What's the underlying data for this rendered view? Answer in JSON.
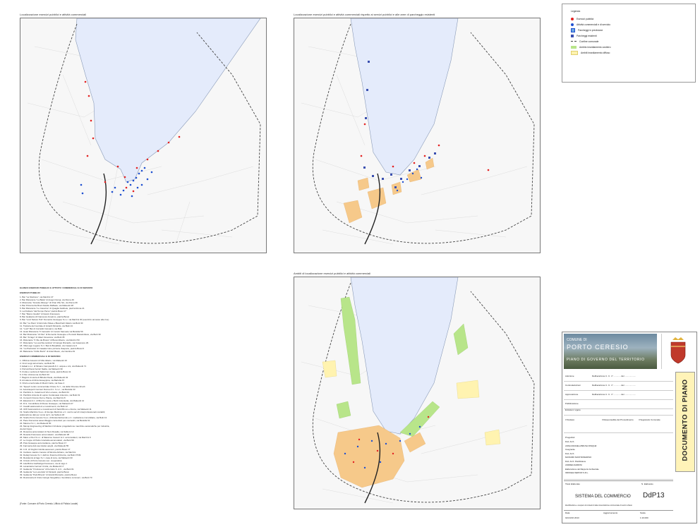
{
  "panels": {
    "p1_title": "Localizzazione esercizi pubblici e attività commerciali",
    "p2_title": "Localizzazione esercizi pubblici e attività commerciali rispetto ai servizi pubblici e alle aree di parcheggio esistenti",
    "p3_title": "Ambiti di localizzazione esercizi pubblici e attività commerciali"
  },
  "colors": {
    "lake": "#e4ebfb",
    "boundary": "#444444",
    "red_dot": "#e32222",
    "blue_dot": "#1e4fd0",
    "parking": "#3a4fb0",
    "orange_area": "#f6c98a",
    "green_area": "#b8e58a",
    "yellow_area": "#fff3b0"
  },
  "legend": {
    "title": "Legenda",
    "items": [
      {
        "label": "Esercizi pubblici",
        "symbol": "red-dot"
      },
      {
        "label": "Attività commerciali e di servizio",
        "symbol": "blue-dot"
      },
      {
        "label": "Parcheggi in previsione",
        "symbol": "parking-planned"
      },
      {
        "label": "Parcheggi esistenti",
        "symbol": "parking-existing"
      },
      {
        "label": "Confine comunale",
        "symbol": "dashed-line"
      },
      {
        "label": "Ambito insediamento costiero",
        "symbol": "green-area"
      },
      {
        "label": "Ambiti insediamento diffuso",
        "symbol": "yellow-area"
      }
    ]
  },
  "list": {
    "heading": "ELENCO ESERCIZI PUBBLICI E ATTIVITA' COMMERCIALI E DI SERVIZIO",
    "section1": "ESERCIZI PUBBLICI",
    "pubblici": [
      "1. Bar \"La Stazione\", via Mazzini 47",
      "2. Bar Ristorante \"La Baita\" di Avogni Giorgi, via Roma 49",
      "3. Ristorante \"Grande Albergo\" di Chan Wiu Sin, via Roma 36",
      "4. Bar Pizzeria Da Bruci Davide Raffaele, via Matteotti 28",
      "5. Bar Ristorante \"Le Casorine\" di Quaglia Gabriele, piazza Roma 21",
      "6. La Flottiera \"dal Tempo Perso\" piazza Bossi 17",
      "7. Bar \"Marco Giudici\" di Gianni Francesco",
      "8. Bar Gelateria di Francesco Anselmo, piazza Bossi",
      "9. Bar \"Lord Nelson Pub\" Demetrio Giuseppe S.n.c. via Mazzini 30 (esercizio annesso alle rive)",
      "10. Bar \"La Pace\" di Ermindo Palea e Bianchetti Valerio via Butti 30",
      "11. Trattoria del Centrale di Girardi Riccardo, via Butti 13",
      "12. \"Lord\" Bar di Corradini Giovanni, via Butti",
      "13. Hotel Ristorante \"Il Cannello\" di Corsini Samuele via Bartolla 59",
      "14. Bar Ristorante \"Al Pan\" di Demetrio Giuseppe e Ponzetti Massimiliano, via Butti 30",
      "15. Bar \"Al lago\" di Valeri Giovanna, via Butti 35",
      "16. Ristorante \"Il Vile da Brusio\" di Bussi Alberto, via Mazzini 50",
      "17. Ristorante \"La vecchia cantina\" di Giorgio Riccardo, via Casamore 29",
      "18. Villa Lago Lugano S.r.l. Bed & Breakfast, via Casamore 6",
      "19. \"La Piazzetta\" di Casadei Gino pizzeria d'asporto, piazza Bossi 6",
      "20. Bialorante \"Cirillo Buzzi\" di Antel Mauro, via Cantina 29"
    ],
    "section2": "ESERCIZI COMMERCIALI E DI SERVIZIO",
    "commerciali": [
      "1. Officina Caresini di Villa Valerio, via Matteotti 16",
      "2. Cinci Luigi carrozzeria, via Butti 56",
      "3. Edaal s.n.c. di Silvano Campanelli & C. acqua e vini, via Matteotti 71",
      "4. Parrucchiera Ferrari Nadia, via Matteotti 30",
      "5. Frutta e verdura di Salzorioni Ivana, piazza Bossi 11",
      "6. Il Pan di Ercenna via Butti 30",
      "7. Bagnini di storia di Bibollo Paola, via Matteotti 34",
      "8. Arrotatore di Riza Giuseppina, via Bartolla 67",
      "9. Ortolo emozionale di Mesiri Carla, via Fase 4",
      "10. 'Speed' centro commerciale Ortone S.r.l., via della Ortensie 30 a/b",
      "11. Autotrasporti Cernieri Donna & C. S.n.c., via Bartolla 33",
      "12. Panificio G. Caterina di Vito Loruoso, via Butti 64",
      "13. Panificio Arcieria di Lupico Cordenasio Antonino, via Butti 19",
      "14. Consorzi Franco Fiori e Piante, via Mazzini 8",
      "15. Elsacrat & C. di Bruzzo Laura e Buzzi Antonietta, via Matteotti 12",
      "16. R.G. Immobiliare di Russo Giuseppe, via Matteotti 27",
      "17. Cavalli assicurazioni e investimenti, via Butti 12",
      "18. UFP Assicurazioni e investimenti di Sardi Bruno e Zocca, via Matteotti 11",
      "19. Studio Marzinio S.a.s. di Giorgio Marzinio e C. centro servizi interprofessionali contabili,",
      "     elaborazione dati per conto terzi, via Sabioni 18",
      "20. Studio Porto Ceresio S.a.s. di Ruistel Edmondo e C. mediazione immobiliare, via Butti 13",
      "21. Pace Domenica assemblaggio contenitori per cosmetici, via Bartolla 91",
      "22. Maxmei S.r.l., via Matteotti 50",
      "23. Menop Engineering di Madrioni Cristiano progettazione macchine automatiche per industria,",
      "     via del Cigno",
      "24. Rosanna accumulatori di Neni Rosalia, via Sabioni 12",
      "25. Rosaria Francesco accumulatori, via Matteotti 38",
      "26. Macs e Pieri S.n.c. di Massimo Cessori & C. accumulatori, via Mazzini 9",
      "27. Le Coppe di Pettio Graziella accumulatori, via Butti 59",
      "28. Pola Giuseppe accumulatore, piazza Bossi 17",
      "29. Farmacia dott.ssa Giulia Langhi, via Matteotti 55",
      "30. C.R. di Vinghini Girolla ascensori, piazza Bossi 17",
      "31. Cantiere nautico Ceresio di Monica Adriano, via Mazzini",
      "32. Dettaji Ceresio S.r.l. dell'oro finanza di Roccia, via Butti 37/39",
      "33. Residenza al lago S.r.l. casa di cura, via Matteotti 33",
      "34. Circolo di Porto Ceresio soc. cooperativa",
      "35. Autofficina Garifatriga Francesco, via al Lago 1",
      "36. Lavanderia Cernieri Cinzia, via Matteotti 17",
      "37. Gelateria \"Il Golosone\" di Ferretto S. & C., via Butti 61",
      "38. Gelateria \"La Lucertola\" di Nicoletti, piazza Bossi",
      "39. Gelateria \"Park Brivolo\" di Girardi Riccardo, piazza Bossi",
      "40. Rosticceria di Cristo Giorgio fotografia e rivenditore commerc, via Butti 73"
    ],
    "source": "(Fonte: Comune di Porto Ceresio, Ufficio di Polizia Locale)"
  },
  "title_block": {
    "comune": "COMUNE DI",
    "city": "PORTO CERESIO",
    "plan": "PIANO DI GOVERNO DEL TERRITORIO",
    "vertical_title": "DOCUMENTO DI PIANO",
    "rows": [
      {
        "k": "Adozione",
        "v": "Deliberazione C. C. n° ............ del ..................."
      },
      {
        "k": "Controdeduzioni",
        "v": "Deliberazione C. C. n° ............ del ..................."
      },
      {
        "k": "Approvazione",
        "v": "Deliberazione C. C. n° ............ del ..................."
      },
      {
        "k": "Pubblicazione",
        "v": ""
      },
      {
        "k": "Entrata in vigore",
        "v": ""
      }
    ],
    "cells": [
      "Il Sindaco",
      "Il Responsabile del Procedimento",
      "Il Segretario Comunale"
    ],
    "progetto_label": "Progettisti",
    "progettisti": [
      "Dott. Arch.",
      "ANNA MANUELA BRUSA PASQUE'",
      "Insegnante",
      "Dott. Arch.",
      "MASSIMO MASTROMARINO",
      "Dott. Arch. Pianificatore",
      "ANDREA NARDINI",
      "Elaborazione del Rapporto Ambientale",
      "IDROGEA SERVIZI S.R.L."
    ],
    "title_label": "Titolo Elaborato",
    "code_label": "N. Elaborato",
    "title": "SISTEMA DEL COMMERCIO",
    "code": "DdP13",
    "subtitle": "Identificazione e recupero di contesti di alta concentrazione commerciale di centro urbano",
    "footer": {
      "data_label": "Data",
      "data": "GIUGNO 2013",
      "agg_label": "Aggiornamento",
      "scala_label": "Scala",
      "scala": "1:10.000"
    }
  }
}
